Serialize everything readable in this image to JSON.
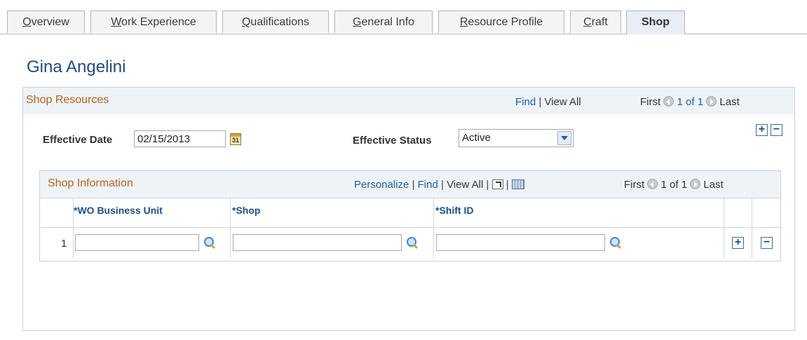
{
  "tabs": [
    {
      "ul": "O",
      "rest": "verview"
    },
    {
      "ul": "W",
      "rest": "ork Experience"
    },
    {
      "ul": "Q",
      "rest": "ualifications"
    },
    {
      "ul": "G",
      "rest": "eneral Info"
    },
    {
      "ul": "R",
      "rest": "esource Profile"
    },
    {
      "ul": "C",
      "rest": "raft"
    },
    {
      "ul": "",
      "rest": "Shop"
    }
  ],
  "page_title": "Gina Angelini",
  "shop_resources": {
    "title": "Shop Resources",
    "find": "Find",
    "separator": "|",
    "view_all": "View All",
    "first": "First",
    "count": "1 of 1",
    "last": "Last",
    "effective_date_label": "Effective Date",
    "effective_date_value": "02/15/2013",
    "calendar_glyph": "31",
    "effective_status_label": "Effective Status",
    "effective_status_value": "Active",
    "add_symbol": "+",
    "remove_symbol": "−"
  },
  "shop_information": {
    "title": "Shop Information",
    "personalize": "Personalize",
    "find": "Find",
    "view_all": "View All",
    "separator": "|",
    "first": "First",
    "count": "1 of 1",
    "last": "Last",
    "columns": [
      "*WO Business Unit",
      "*Shop",
      "*Shift ID"
    ],
    "rows": [
      {
        "num": "1",
        "wo_business_unit": "",
        "shop": "",
        "shift_id": ""
      }
    ]
  }
}
